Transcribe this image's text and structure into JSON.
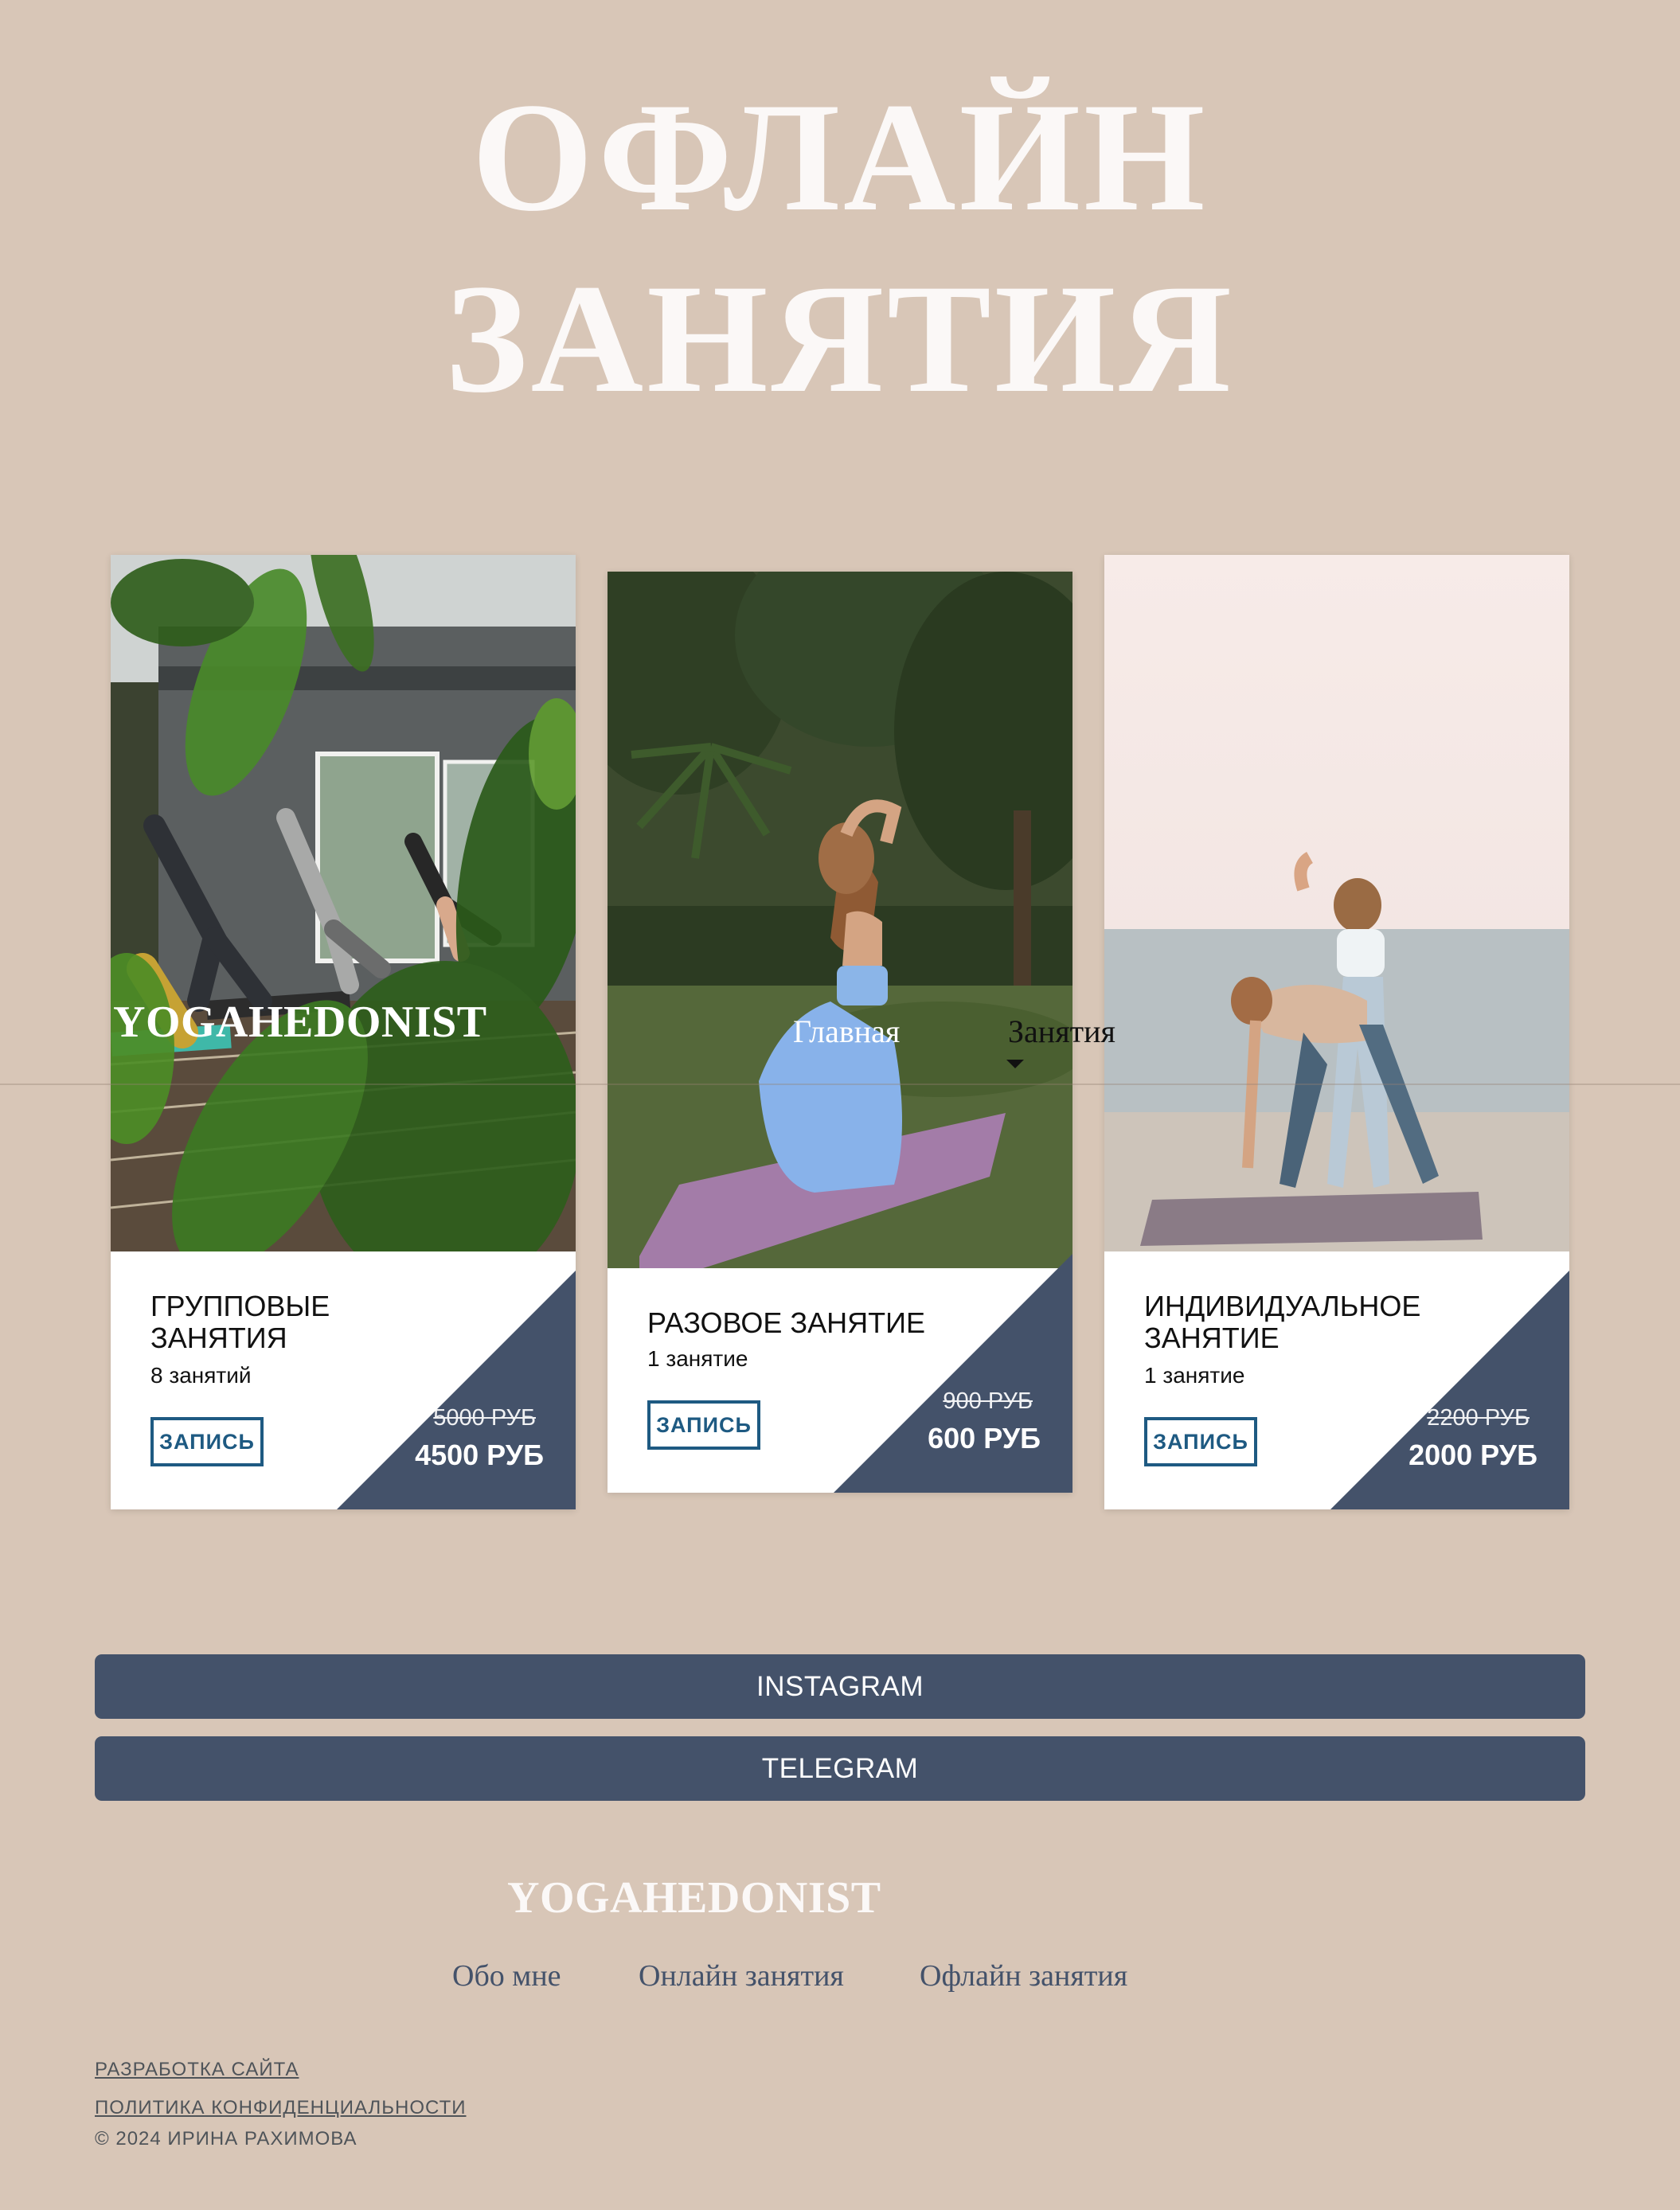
{
  "hero": {
    "line1": "ОФЛАЙН",
    "line2": "ЗАНЯТИЯ"
  },
  "header": {
    "logo": "YOGAHEDONIST",
    "nav": {
      "home": "Главная",
      "classes": "Занятия"
    }
  },
  "cards": [
    {
      "title_line1": "ГРУППОВЫЕ",
      "title_line2": "ЗАНЯТИЯ",
      "subtitle": "8 занятий",
      "button": "ЗАПИСЬ",
      "old_price": "5000 РУБ",
      "price": "4500 РУБ"
    },
    {
      "title_line1": "РАЗОВОЕ ЗАНЯТИЕ",
      "subtitle": "1 занятие",
      "button": "ЗАПИСЬ",
      "old_price": "900 РУБ",
      "price": "600 РУБ"
    },
    {
      "title_line1": "ИНДИВИДУАЛЬНОЕ",
      "title_line2": "ЗАНЯТИЕ",
      "subtitle": "1 занятие",
      "button": "ЗАПИСЬ",
      "old_price": "2200 РУБ",
      "price": "2000 РУБ"
    }
  ],
  "social": {
    "instagram": "INSTAGRAM",
    "telegram": "TELEGRAM"
  },
  "footer": {
    "logo": "YOGAHEDONIST",
    "nav": [
      "Обо мне",
      "Онлайн занятия",
      "Офлайн занятия"
    ],
    "dev_link": "РАЗРАБОТКА САЙТА",
    "privacy_link": "ПОЛИТИКА КОНФИДЕНЦИАЛЬНОСТИ",
    "copyright": "© 2024 ИРИНА РАХИМОВА"
  },
  "colors": {
    "background": "#d8c6b7",
    "accent": "#44526a",
    "button_border": "#1e5a82",
    "hero_text": "#fbf8f7"
  }
}
